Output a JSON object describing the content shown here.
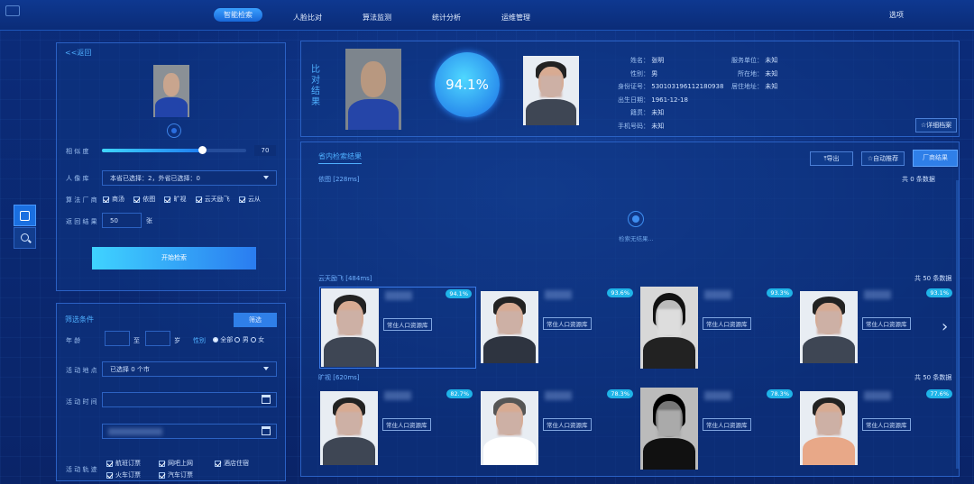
{
  "nav": {
    "items": [
      "智能检索",
      "人脸比对",
      "算法监测",
      "统计分析",
      "运维管理"
    ],
    "right": "选项"
  },
  "left": {
    "back": "<<返回",
    "similarity_label": "相 似 度",
    "similarity_value": "70",
    "library_label": "人 像 库",
    "library_value": "本省已选择：2，外省已选择：0",
    "vendor_label": "算 法 厂 商",
    "vendors": [
      "商汤",
      "依图",
      "旷视",
      "云天励飞",
      "云从"
    ],
    "return_label": "返 回 结 果",
    "return_value": "50",
    "return_unit": "张",
    "search_btn": "开始检索",
    "filter_title": "筛选条件",
    "filter_btn": "筛选",
    "age_label": "年 龄",
    "age_to": "至",
    "age_unit": "岁",
    "gender_label": "性别",
    "gender_options": [
      "全部",
      "男",
      "女"
    ],
    "place_label": "活 动 地 点",
    "place_value": "已选择 0 个市",
    "time_label": "活 动 时 间",
    "track_label": "活 动 轨 迹",
    "tracks": [
      "航班订票",
      "网吧上网",
      "酒店住宿",
      "火车订票",
      "汽车订票"
    ]
  },
  "compare": {
    "title": "比对结果",
    "score": "94.1%",
    "fields": {
      "name_k": "姓名：",
      "name_v": "张明",
      "gender_k": "性别：",
      "gender_v": "男",
      "id_k": "身份证号：",
      "id_v": "530103196112180938",
      "birth_k": "出生日期：",
      "birth_v": "1961-12-18",
      "origin_k": "籍贯：",
      "origin_v": "未知",
      "phone_k": "手机号码：",
      "phone_v": "未知",
      "unit_k": "服务单位：",
      "unit_v": "未知",
      "loc_k": "所在地：",
      "loc_v": "未知",
      "addr_k": "居住地址：",
      "addr_v": "未知"
    },
    "detail_btn": "☆详细档案"
  },
  "results": {
    "tab": "省内检索结果",
    "export_btn": "导出",
    "recommend_btn": "☆自动推荐",
    "vendor_btn": "厂商结果",
    "s1_title": "依图 [228ms]",
    "s1_count": "共 0 条数据",
    "empty": "检索无结果...",
    "s2_title": "云天励飞 [484ms]",
    "s2_count": "共 50 条数据",
    "s2_pcts": [
      "94.1%",
      "93.6%",
      "93.3%",
      "93.1%"
    ],
    "s3_title": "旷视 [620ms]",
    "s3_count": "共 50 条数据",
    "s3_pcts": [
      "82.7%",
      "78.3%",
      "78.3%",
      "77.6%"
    ],
    "tag": "常住人口资源库"
  }
}
